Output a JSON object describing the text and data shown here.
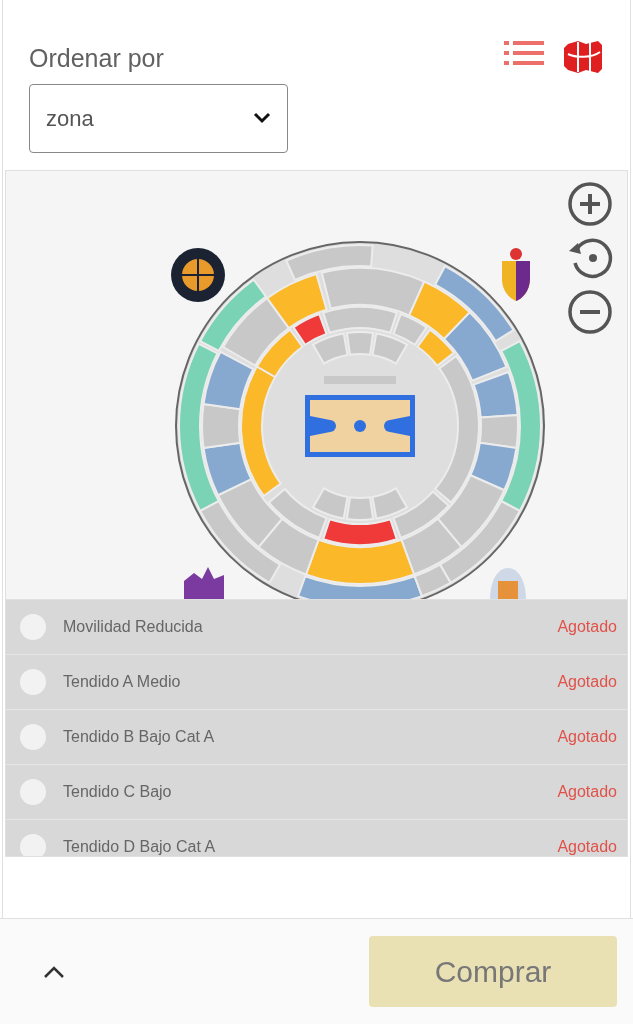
{
  "sort": {
    "label": "Ordenar por",
    "value": "zona"
  },
  "view_toggle": [
    {
      "kind": "list",
      "selected": false
    },
    {
      "kind": "map",
      "selected": true
    }
  ],
  "zones": [
    {
      "name": "Movilidad Reducida",
      "status": "Agotado",
      "selected": false
    },
    {
      "name": "Tendido A Medio",
      "status": "Agotado",
      "selected": false
    },
    {
      "name": "Tendido B Bajo Cat A",
      "status": "Agotado",
      "selected": false
    },
    {
      "name": "Tendido C Bajo",
      "status": "Agotado",
      "selected": false
    },
    {
      "name": "Tendido D Bajo Cat A",
      "status": "Agotado",
      "selected": false
    }
  ],
  "footer": {
    "button": "Comprar",
    "disabled": true
  }
}
